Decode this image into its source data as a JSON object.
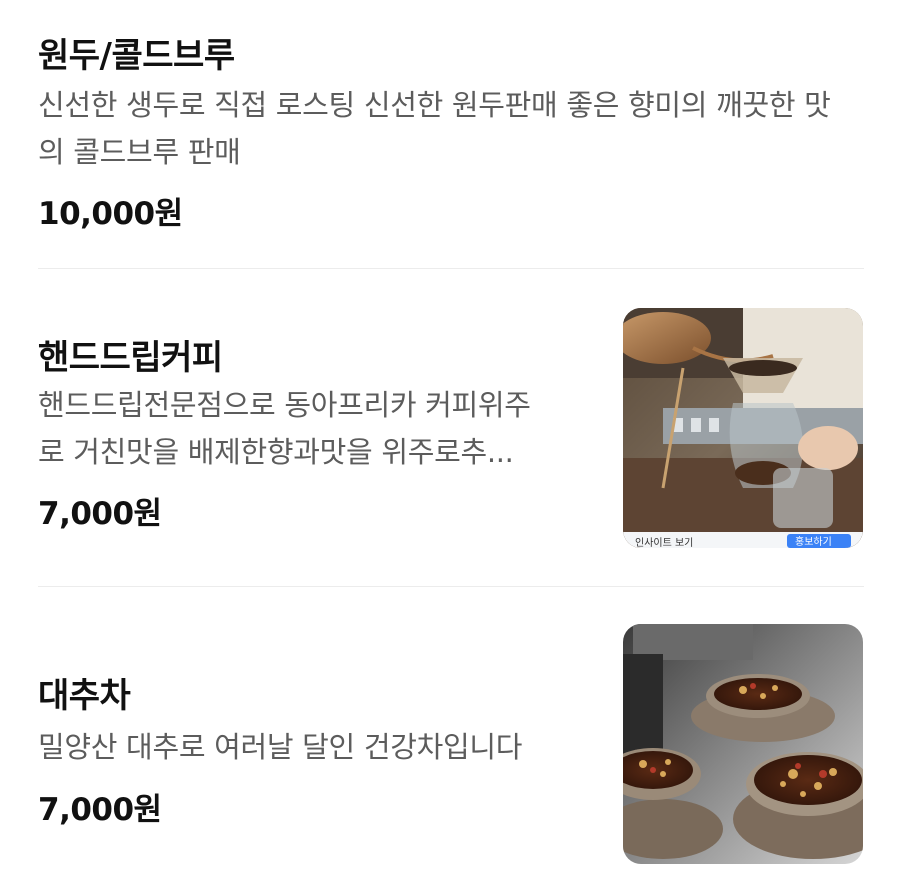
{
  "items": [
    {
      "title": "원두/콜드브루",
      "description": "신선한 생두로 직접 로스팅 신선한 원두판매 좋은 향미의 깨끗한 맛의 콜드브루 판매",
      "price": "10,000원"
    },
    {
      "title": "핸드드립커피",
      "description_lines": [
        "핸드드립전문점으로 동아프리카 커피위주",
        "로 거친맛을 배제한향과맛을 위주로추..."
      ],
      "price": "7,000원",
      "image": "hand-drip-coffee-photo"
    },
    {
      "title": "대추차",
      "description": "밀양산 대추로 여러날 달인 건강차입니다",
      "price": "7,000원",
      "image": "jujube-tea-photo"
    }
  ],
  "colors": {
    "title": "#111111",
    "description": "#5c5c5c",
    "divider": "#ececec"
  }
}
